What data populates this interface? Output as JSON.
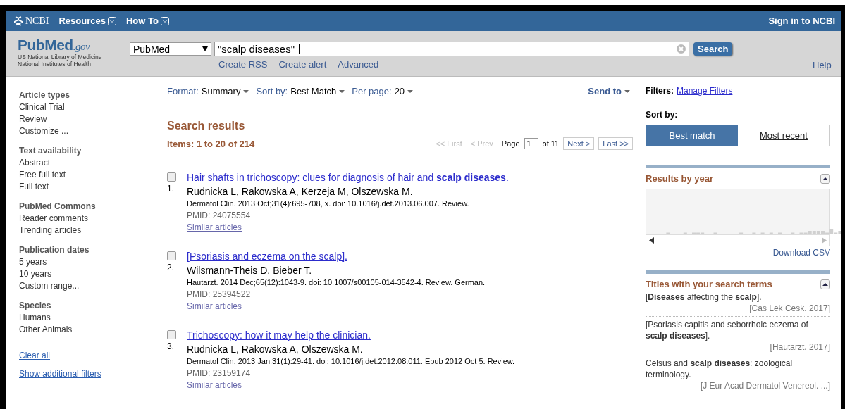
{
  "topbar": {
    "brand": "NCBI",
    "menus": [
      "Resources",
      "How To"
    ],
    "signin": "Sign in to NCBI"
  },
  "header": {
    "logo_main": "PubMed",
    "logo_suffix": ".gov",
    "logo_lines": [
      "US National Library of Medicine",
      "National Institutes of Health"
    ],
    "database": "PubMed",
    "query": "\"scalp diseases\"",
    "search_button": "Search",
    "links": [
      "Create RSS",
      "Create alert",
      "Advanced"
    ],
    "help": "Help"
  },
  "sidebar": {
    "groups": [
      {
        "title": "Article types",
        "items": [
          "Clinical Trial",
          "Review",
          "Customize ..."
        ]
      },
      {
        "title": "Text availability",
        "items": [
          "Abstract",
          "Free full text",
          "Full text"
        ]
      },
      {
        "title": "PubMed Commons",
        "items": [
          "Reader comments",
          "Trending articles"
        ]
      },
      {
        "title": "Publication dates",
        "items": [
          "5 years",
          "10 years",
          "Custom range..."
        ]
      },
      {
        "title": "Species",
        "items": [
          "Humans",
          "Other Animals"
        ]
      }
    ],
    "clear_all": "Clear all",
    "show_filters": "Show additional filters"
  },
  "toolbar": {
    "options": [
      {
        "label": "Format:",
        "value": "Summary"
      },
      {
        "label": "Sort by:",
        "value": "Best Match"
      },
      {
        "label": "Per page:",
        "value": "20"
      }
    ],
    "send_to": "Send to"
  },
  "results": {
    "title": "Search results",
    "count": "Items: 1 to 20 of 214",
    "pager": {
      "first": "<< First",
      "prev": "< Prev",
      "page_label": "Page",
      "page": "1",
      "of": "of 11",
      "next": "Next >",
      "last": "Last >>"
    },
    "items": [
      {
        "number": "1.",
        "checked": false,
        "title": "Hair shafts in trichoscopy: clues for diagnosis of hair and **scalp diseases**.",
        "authors": "Rudnicka L, Rakowska A, Kerzeja M, Olszewska M.",
        "citation": "Dermatol Clin. 2013 Oct;31(4):695-708, x. doi: 10.1016/j.det.2013.06.007. Review.",
        "pmid": "PMID: 24075554",
        "similar": "Similar articles"
      },
      {
        "number": "2.",
        "checked": false,
        "title": "[Psoriasis and eczema on the scalp].",
        "authors": "Wilsmann-Theis D, Bieber T.",
        "citation": "Hautarzt. 2014 Dec;65(12):1043-9. doi: 10.1007/s00105-014-3542-4. Review. German.",
        "pmid": "PMID: 25394522",
        "similar": "Similar articles"
      },
      {
        "number": "3.",
        "checked": false,
        "title": "Trichoscopy: how it may help the clinician.",
        "authors": "Rudnicka L, Rakowska A, Olszewska M.",
        "citation": "Dermatol Clin. 2013 Jan;31(1):29-41. doi: 10.1016/j.det.2012.08.011. Epub 2012 Oct 5. Review.",
        "pmid": "PMID: 23159174",
        "similar": "Similar articles"
      }
    ]
  },
  "right": {
    "filters_label": "Filters:",
    "manage_filters": "Manage Filters",
    "sort_label": "Sort by:",
    "sort_tabs": [
      {
        "label": "Best match",
        "selected": true
      },
      {
        "label": "Most recent",
        "selected": false
      }
    ],
    "by_year": {
      "title": "Results by year",
      "download": "Download CSV"
    },
    "titles": {
      "title": "Titles with your search terms",
      "items": [
        {
          "title": "[**Diseases** affecting the **scalp**].",
          "source": "[Cas Lek Cesk. 2017]"
        },
        {
          "title": "[Psoriasis capitis and seborrhoic eczema of **scalp diseases**].",
          "source": "[Hautarzt. 2017]"
        },
        {
          "title": "Celsus and **scalp diseases**: zoological terminology.",
          "source": "[J Eur Acad Dermatol Venereol. ...]"
        }
      ]
    }
  }
}
